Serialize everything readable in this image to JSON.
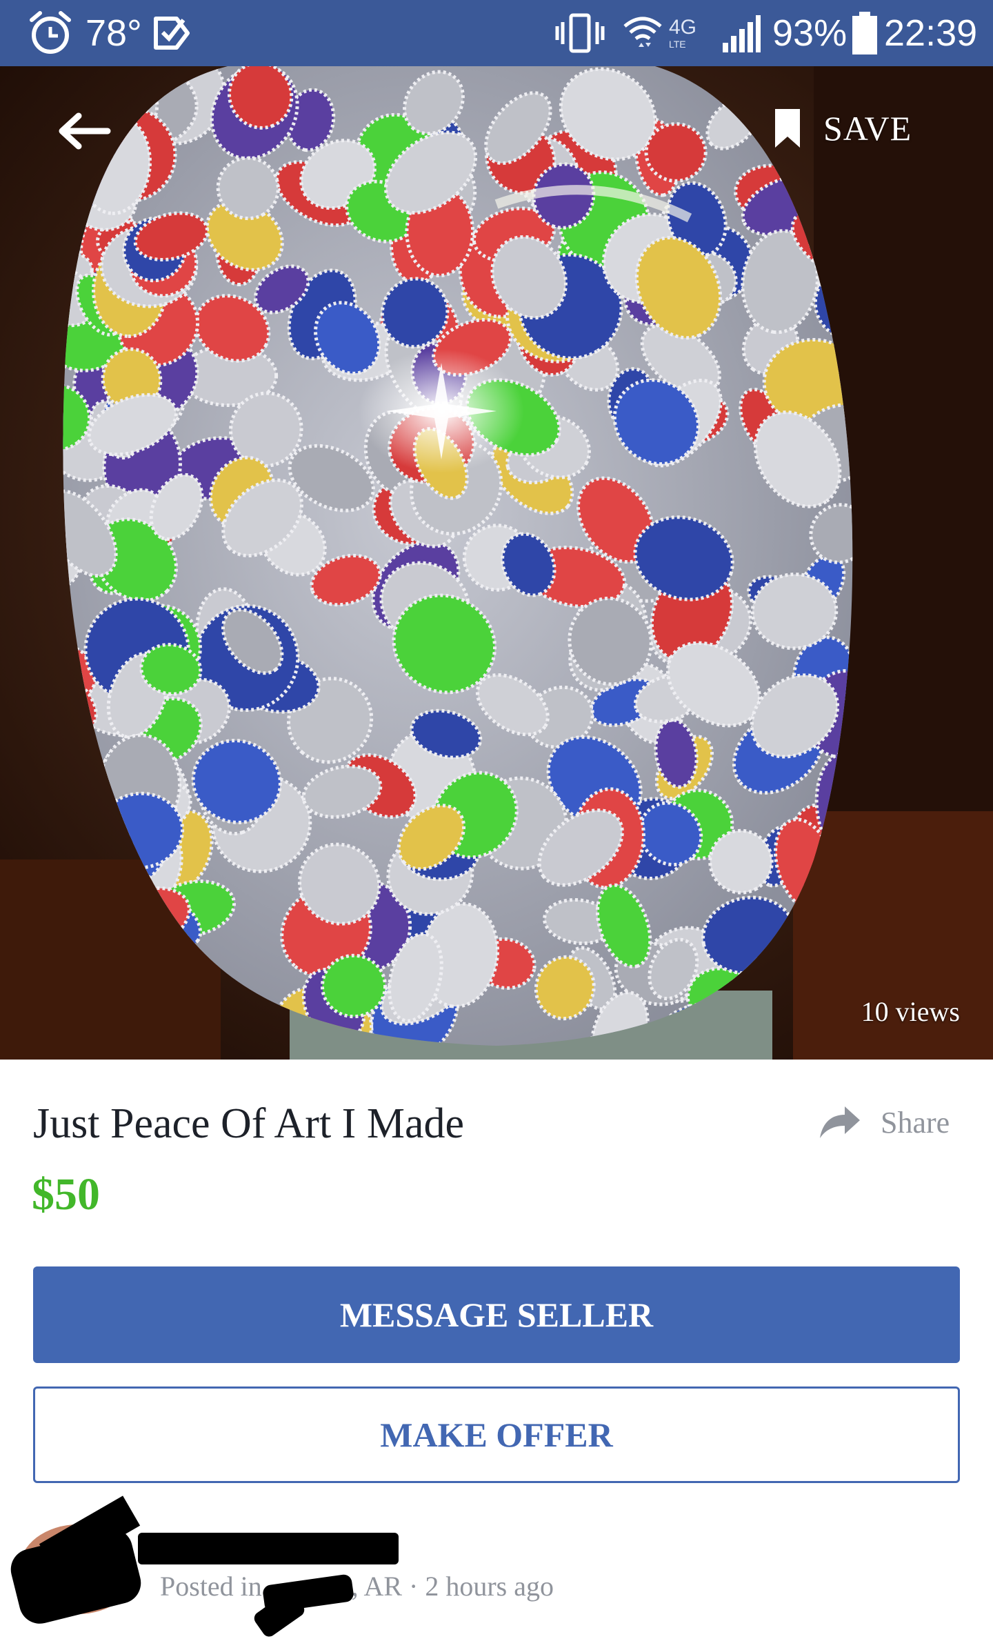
{
  "status_bar": {
    "temperature": "78°",
    "network": "4G",
    "network_sub": "LTE",
    "battery": "93%",
    "time": "22:39"
  },
  "photo": {
    "save_label": "SAVE",
    "views": "10 views"
  },
  "listing": {
    "title": "Just Peace Of Art I Made",
    "share_label": "Share",
    "price": "$50"
  },
  "actions": {
    "message_seller": "MESSAGE SELLER",
    "make_offer": "MAKE OFFER"
  },
  "seller": {
    "meta": "Posted in ·········, AR · 2 hours ago"
  },
  "colors": {
    "status_bar": "#3b5998",
    "primary": "#4267b2",
    "price": "#42b72a",
    "muted": "#90949c"
  },
  "icons": [
    "alarm-icon",
    "check-icon",
    "vibrate-icon",
    "wifi-icon",
    "signal-icon",
    "battery-icon",
    "back-arrow-icon",
    "bookmark-icon",
    "share-arrow-icon"
  ]
}
